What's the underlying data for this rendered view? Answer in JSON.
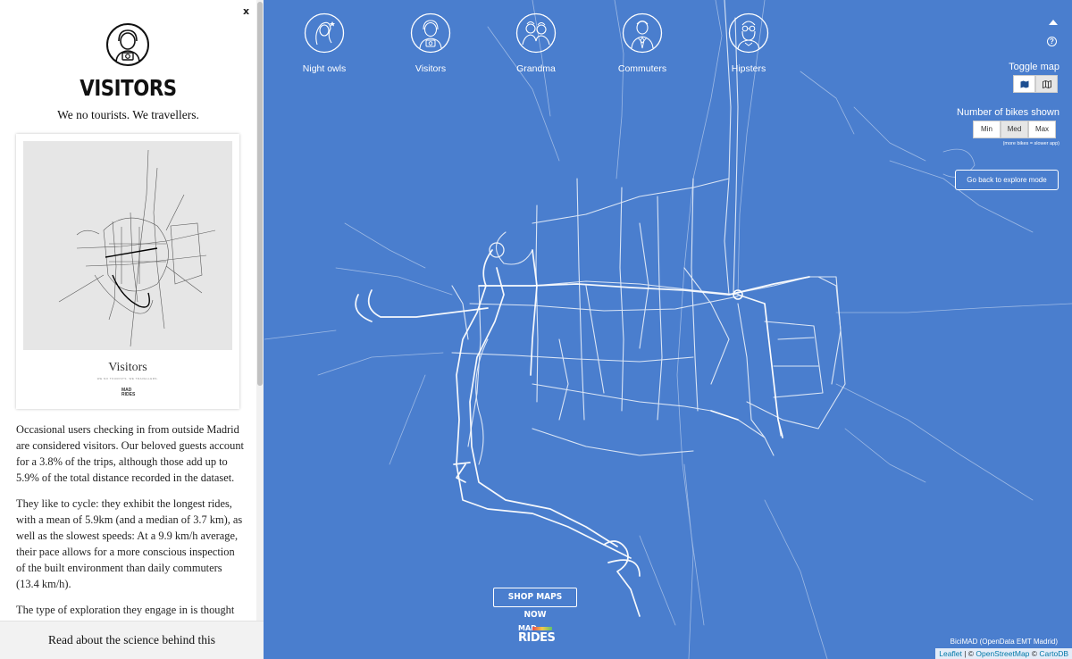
{
  "sidebar": {
    "close_label": "x",
    "persona_icon": "visitor-camera-icon",
    "title": "VISITORS",
    "tagline": "We no tourists. We travellers.",
    "poster": {
      "title": "Visitors",
      "subtitle": "WE NO TOURISTS. WE TRAVELLERS.",
      "logo_line1": "MAD",
      "logo_line2": "RIDES"
    },
    "paragraphs": [
      "Occasional users checking in from outside Madrid are considered visitors. Our beloved guests account for a 3.8% of the trips, although those add up to 5.9% of the total distance recorded in the dataset.",
      "They like to cycle: they exhibit the longest rides, with a mean of 5.9km (and a median of 3.7 km), as well as the slowest speeds: At a 9.9 km/h average, their pace allows for a more conscious inspection of the built environment than daily commuters (13.4 km/h).",
      "The type of exploration they engage in is thought to be"
    ],
    "science_link": "Read about the science behind this"
  },
  "personas": [
    {
      "label": "Night owls",
      "icon": "night-owl-icon"
    },
    {
      "label": "Visitors",
      "icon": "visitor-icon"
    },
    {
      "label": "Grandma",
      "icon": "grandma-icon"
    },
    {
      "label": "Commuters",
      "icon": "commuter-icon"
    },
    {
      "label": "Hipsters",
      "icon": "hipster-icon"
    }
  ],
  "controls": {
    "toggle_map_label": "Toggle map",
    "toggle_options": [
      "map-icon",
      "map-folded-icon"
    ],
    "toggle_active": 1,
    "bikes_label": "Number of bikes shown",
    "bikes_options": [
      "Min",
      "Med",
      "Max"
    ],
    "bikes_active": 1,
    "bikes_note": "(more bikes = slower app)",
    "explore_button": "Go back to explore mode"
  },
  "footer": {
    "shop_button": "SHOP MAPS NOW",
    "logo_line1": "MAD",
    "logo_line2": "RIDES",
    "attribution": "BiciMAD (OpenData EMT Madrid)",
    "leaflet": "Leaflet",
    "separator": " | © ",
    "osm": "OpenStreetMap",
    "separator2": " © ",
    "cartodb": "CartoDB"
  },
  "colors": {
    "map_background": "#4a7ece",
    "route_lines": "#ffffff",
    "sidebar_background": "#ffffff"
  }
}
